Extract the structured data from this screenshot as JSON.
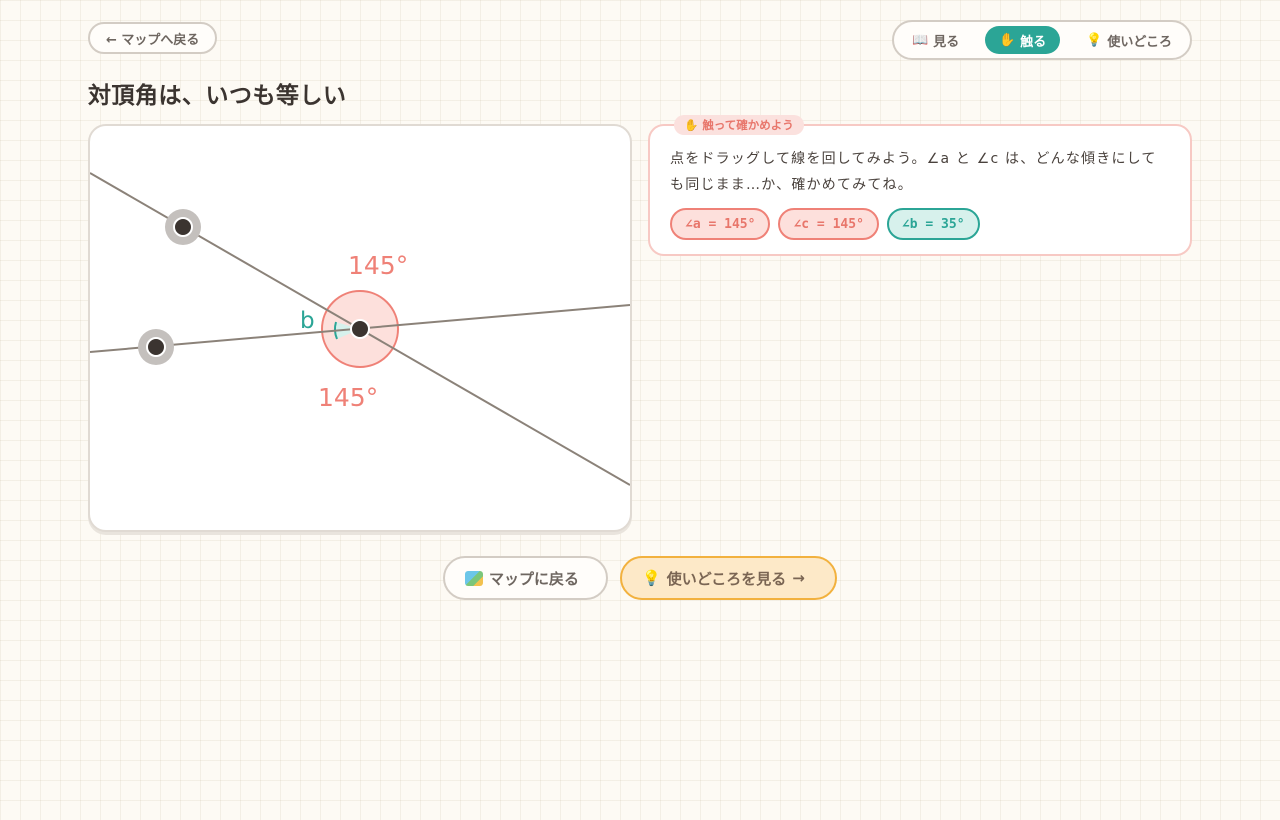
{
  "header": {
    "back_label": "← マップへ戻る",
    "tabs": [
      {
        "icon": "📖",
        "label": "見る",
        "active": false
      },
      {
        "icon": "✋",
        "label": "触る",
        "active": true
      },
      {
        "icon": "💡",
        "label": "使いどころ",
        "active": false
      }
    ]
  },
  "title": "対頂角は、いつも等しい",
  "diagram": {
    "angle_a_label": "145°",
    "angle_c_label": "145°",
    "angle_b_label": "b"
  },
  "info": {
    "tag_icon": "✋",
    "tag_label": "触って確かめよう",
    "text": "点をドラッグして線を回してみよう。∠a と ∠c は、どんな傾きにしても同じまま…か、確かめてみてね。",
    "chips": [
      {
        "label": "∠a = 145°",
        "color": "red"
      },
      {
        "label": "∠c = 145°",
        "color": "red"
      },
      {
        "label": "∠b = 35°",
        "color": "teal"
      }
    ]
  },
  "footer": {
    "map_label": "マップに戻る",
    "uses_label": "使いどころを見る",
    "uses_arrow": "→"
  },
  "colors": {
    "accent_teal": "#2ba596",
    "angle_red": "#ef8177",
    "warm_orange": "#f2b13e",
    "line_gray": "#8b8279"
  }
}
